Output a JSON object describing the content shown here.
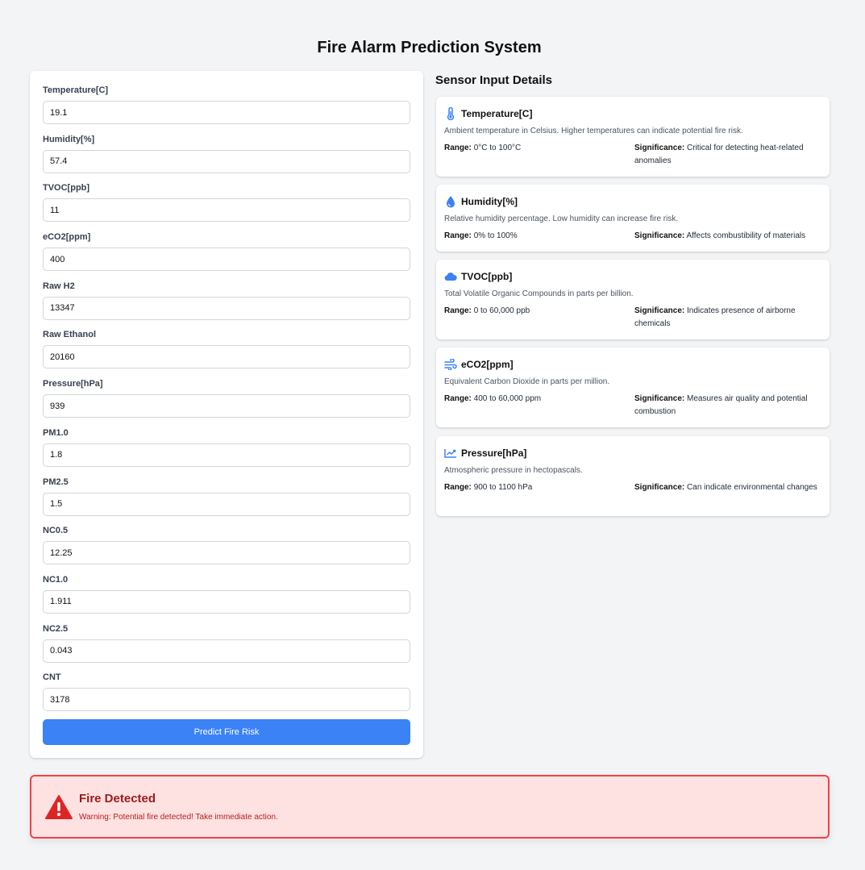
{
  "page": {
    "title": "Fire Alarm Prediction System"
  },
  "form": {
    "fields": [
      {
        "label": "Temperature[C]",
        "value": "19.1"
      },
      {
        "label": "Humidity[%]",
        "value": "57.4"
      },
      {
        "label": "TVOC[ppb]",
        "value": "11"
      },
      {
        "label": "eCO2[ppm]",
        "value": "400"
      },
      {
        "label": "Raw H2",
        "value": "13347"
      },
      {
        "label": "Raw Ethanol",
        "value": "20160"
      },
      {
        "label": "Pressure[hPa]",
        "value": "939"
      },
      {
        "label": "PM1.0",
        "value": "1.8"
      },
      {
        "label": "PM2.5",
        "value": "1.5"
      },
      {
        "label": "NC0.5",
        "value": "12.25"
      },
      {
        "label": "NC1.0",
        "value": "1.911"
      },
      {
        "label": "NC2.5",
        "value": "0.043"
      },
      {
        "label": "CNT",
        "value": "3178"
      }
    ],
    "submit_label": "Predict Fire Risk"
  },
  "details": {
    "title": "Sensor Input Details",
    "range_key": "Range:",
    "significance_key": "Significance:",
    "cards": [
      {
        "icon": "thermometer-icon",
        "title": "Temperature[C]",
        "description": "Ambient temperature in Celsius. Higher temperatures can indicate potential fire risk.",
        "range": "0°C to 100°C",
        "significance": "Critical for detecting heat-related anomalies"
      },
      {
        "icon": "droplet-icon",
        "title": "Humidity[%]",
        "description": "Relative humidity percentage. Low humidity can increase fire risk.",
        "range": "0% to 100%",
        "significance": "Affects combustibility of materials"
      },
      {
        "icon": "cloud-icon",
        "title": "TVOC[ppb]",
        "description": "Total Volatile Organic Compounds in parts per billion.",
        "range": "0 to 60,000 ppb",
        "significance": "Indicates presence of airborne chemicals"
      },
      {
        "icon": "wind-icon",
        "title": "eCO2[ppm]",
        "description": "Equivalent Carbon Dioxide in parts per million.",
        "range": "400 to 60,000 ppm",
        "significance": "Measures air quality and potential combustion"
      },
      {
        "icon": "trend-chart-icon",
        "title": "Pressure[hPa]",
        "description": "Atmospheric pressure in hectopascals.",
        "range": "900 to 1100 hPa",
        "significance": "Can indicate environmental changes"
      }
    ]
  },
  "alert": {
    "icon": "warning-triangle-icon",
    "title": "Fire Detected",
    "message": "Warning: Potential fire detected! Take immediate action.",
    "colors": {
      "background": "#fee2e2",
      "border": "#ef4444",
      "title": "#991b1b",
      "icon": "#dc2626"
    }
  },
  "colors": {
    "accent": "#3b82f6",
    "icon": "#3b82f6"
  }
}
